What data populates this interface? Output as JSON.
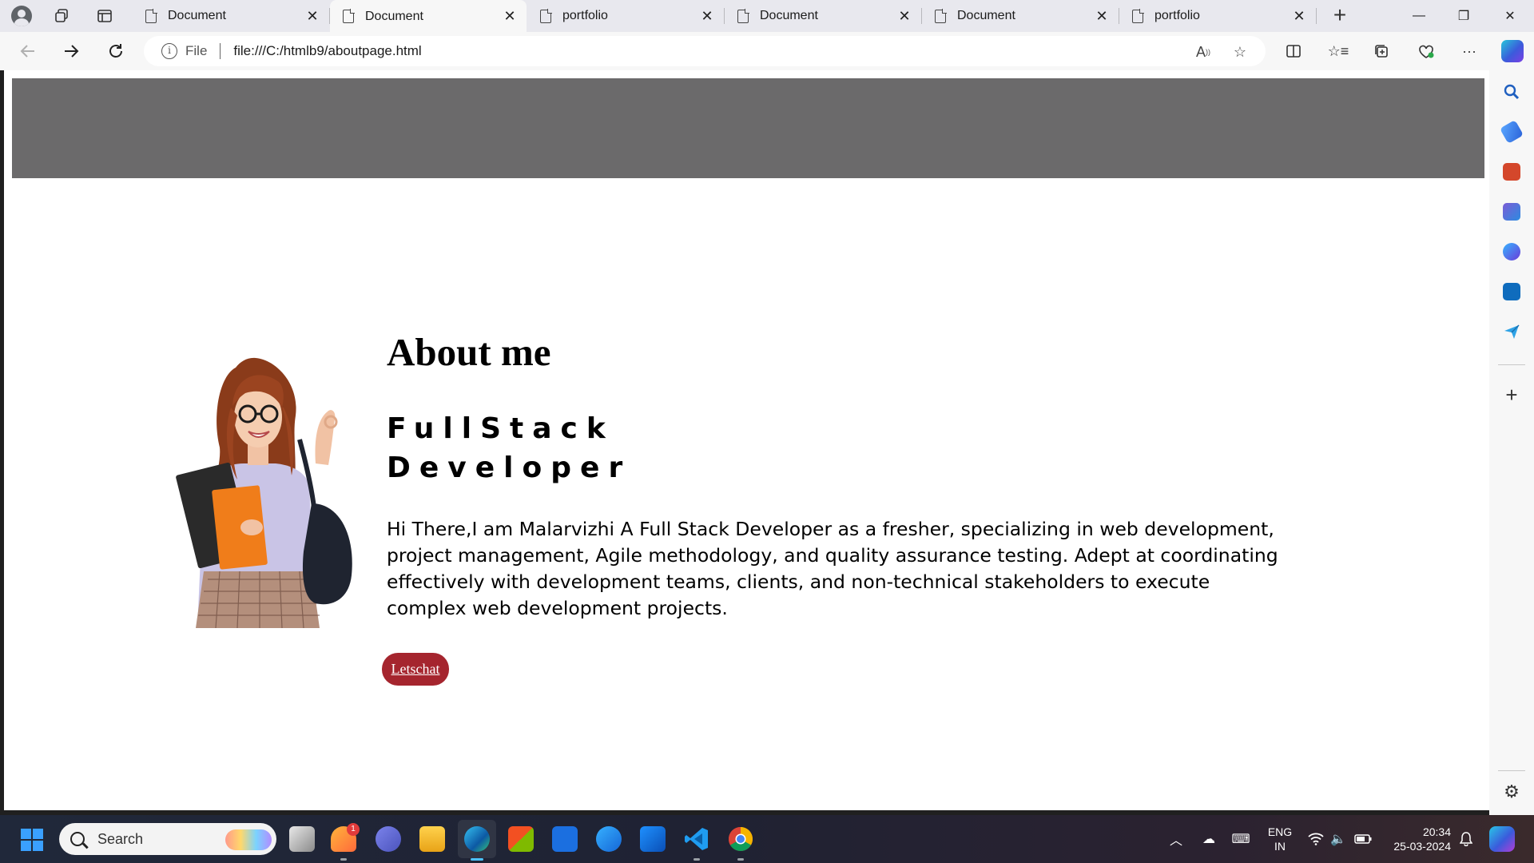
{
  "browser": {
    "tabs": [
      {
        "title": "Document",
        "active": false
      },
      {
        "title": "Document",
        "active": true
      },
      {
        "title": "portfolio",
        "active": false
      },
      {
        "title": "Document",
        "active": false
      },
      {
        "title": "Document",
        "active": false
      },
      {
        "title": "portfolio",
        "active": false
      }
    ],
    "address": {
      "scheme_label": "File",
      "url": "file:///C:/htmlb9/aboutpage.html"
    },
    "window_controls": {
      "minimize": "—",
      "restore": "❐",
      "close": "✕"
    },
    "sidebar_icons": [
      "search-icon",
      "shopping-tag-icon",
      "tools-icon",
      "games-icon",
      "copilot-m365-icon",
      "outlook-icon",
      "send-icon",
      "add-icon",
      "settings-icon"
    ]
  },
  "page": {
    "heading": "About me",
    "role": "FullStack Developer",
    "role_line1": "FullStack",
    "role_line2": "Developer",
    "bio": "Hi There,I am Malarvizhi A Full Stack Developer as a fresher, specializing in web development, project management, Agile methodology, and quality assurance testing. Adept at coordinating effectively with development teams, clients, and non-technical stakeholders to execute complex web development projects.",
    "cta_label": "Letschat",
    "colors": {
      "banner": "#6b6a6b",
      "cta": "#a5252e"
    }
  },
  "taskbar": {
    "search_placeholder": "Search",
    "notification_count": "1",
    "language": {
      "line1": "ENG",
      "line2": "IN"
    },
    "time": "20:34",
    "date": "25-03-2024"
  }
}
